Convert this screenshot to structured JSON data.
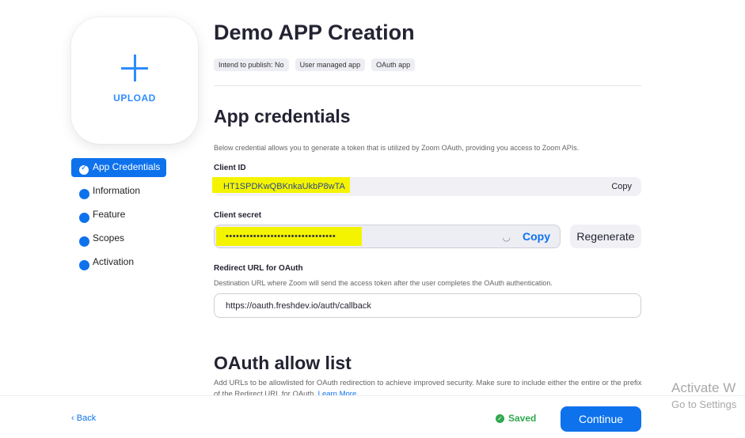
{
  "upload": {
    "label": "UPLOAD",
    "icon": "plus-icon"
  },
  "sidebar": {
    "items": [
      {
        "label": "App Credentials",
        "active": true
      },
      {
        "label": "Information"
      },
      {
        "label": "Feature"
      },
      {
        "label": "Scopes"
      },
      {
        "label": "Activation"
      }
    ]
  },
  "header": {
    "title": "Demo APP Creation",
    "tags": [
      "Intend to publish: No",
      "User managed app",
      "OAuth app"
    ]
  },
  "credentials": {
    "title": "App credentials",
    "description": "Below credential allows you to generate a token that is utilized by Zoom OAuth, providing you access to Zoom APIs.",
    "client_id_label": "Client ID",
    "client_id_value": "HT1SPDKwQBKnkaUkbP8wTA",
    "copy_label": "Copy",
    "client_secret_label": "Client secret",
    "client_secret_value": "••••••••••••••••••••••••••••••••",
    "copy_secret_label": "Copy",
    "regenerate_label": "Regenerate",
    "redirect_label": "Redirect URL for OAuth",
    "redirect_description": "Destination URL where Zoom will send the access token after the user completes the OAuth authentication.",
    "redirect_value": "https://oauth.freshdev.io/auth/callback"
  },
  "allowlist": {
    "title": "OAuth allow list",
    "description": "Add URLs to be allowlisted for OAuth redirection to achieve improved security. Make sure to include either the entire or the prefix of the Redirect URL for OAuth.",
    "learn_more": "Learn More"
  },
  "footer": {
    "back_label": "Back",
    "saved_label": "Saved",
    "continue_label": "Continue"
  },
  "watermark": {
    "title": "Activate W",
    "subtitle": "Go to Settings"
  },
  "colors": {
    "accent": "#0e72ed",
    "saved": "#2fa84f",
    "highlight": "#f4f400"
  }
}
